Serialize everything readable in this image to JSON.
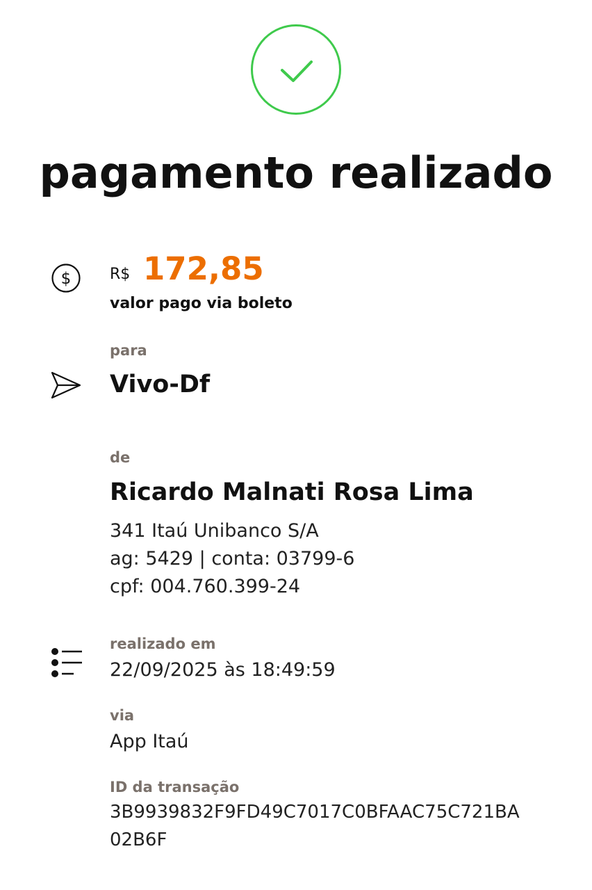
{
  "header": {
    "status_icon": "check-circle-icon",
    "status_color": "#3fca4c",
    "title": "pagamento realizado"
  },
  "amount": {
    "icon": "dollar-circle-icon",
    "currency": "R$",
    "value": "172,85",
    "value_color": "#ec6e00",
    "description": "valor pago via boleto"
  },
  "recipient": {
    "icon": "send-icon",
    "label": "para",
    "name": "Vivo-Df"
  },
  "payer": {
    "label": "de",
    "name": "Ricardo Malnati Rosa Lima",
    "bank": "341 Itaú Unibanco S/A",
    "account": "ag: 5429 | conta: 03799-6",
    "cpf": "cpf: 004.760.399-24"
  },
  "details": {
    "icon": "list-icon",
    "date_label": "realizado em",
    "date_value": "22/09/2025 às 18:49:59",
    "via_label": "via",
    "via_value": "App Itaú",
    "id_label": "ID da transação",
    "id_line1": "3B9939832F9FD49C7017C0BFAAC75C721BA",
    "id_line2": "02B6F"
  }
}
